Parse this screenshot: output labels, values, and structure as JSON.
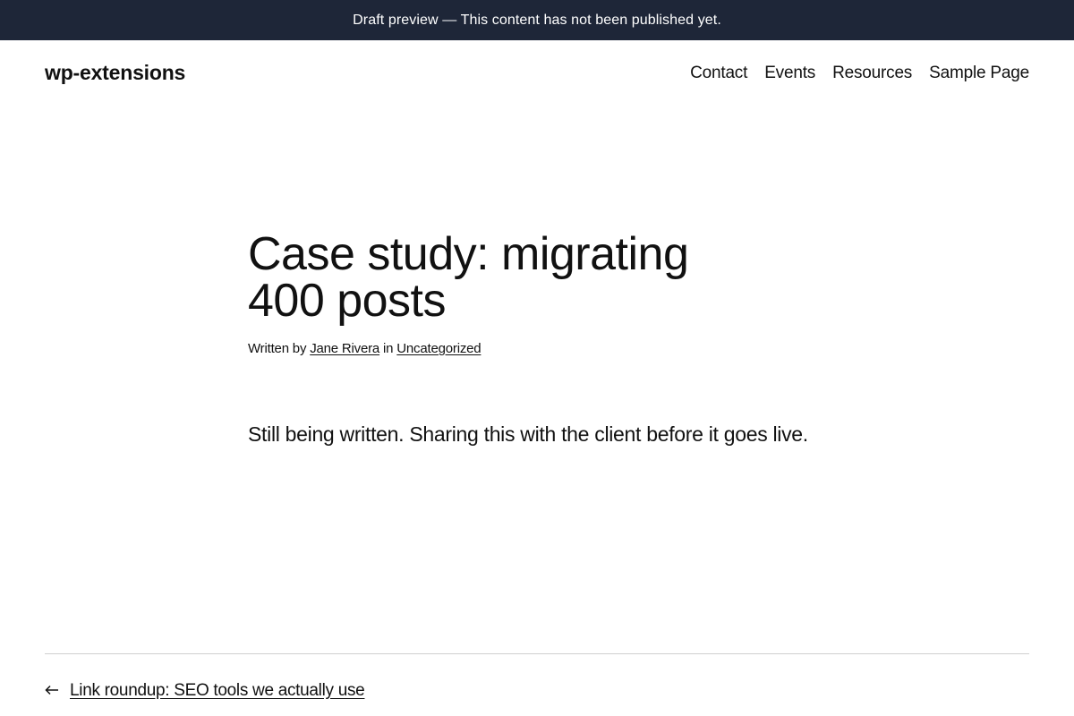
{
  "banner": {
    "strong": "Draft preview",
    "rest": " — This content has not been published yet."
  },
  "header": {
    "site_title": "wp-extensions",
    "nav": [
      "Contact",
      "Events",
      "Resources",
      "Sample Page"
    ]
  },
  "post": {
    "title": "Case study: migrating 400 posts",
    "byline_prefix": "Written by ",
    "author": "Jane Rivera",
    "byline_mid": " in ",
    "category": "Uncategorized",
    "body": "Still being written. Sharing this with the client before it goes live."
  },
  "post_navigation": {
    "previous_icon": "arrow-left-icon",
    "previous_label": "Link roundup: SEO tools we actually use"
  }
}
